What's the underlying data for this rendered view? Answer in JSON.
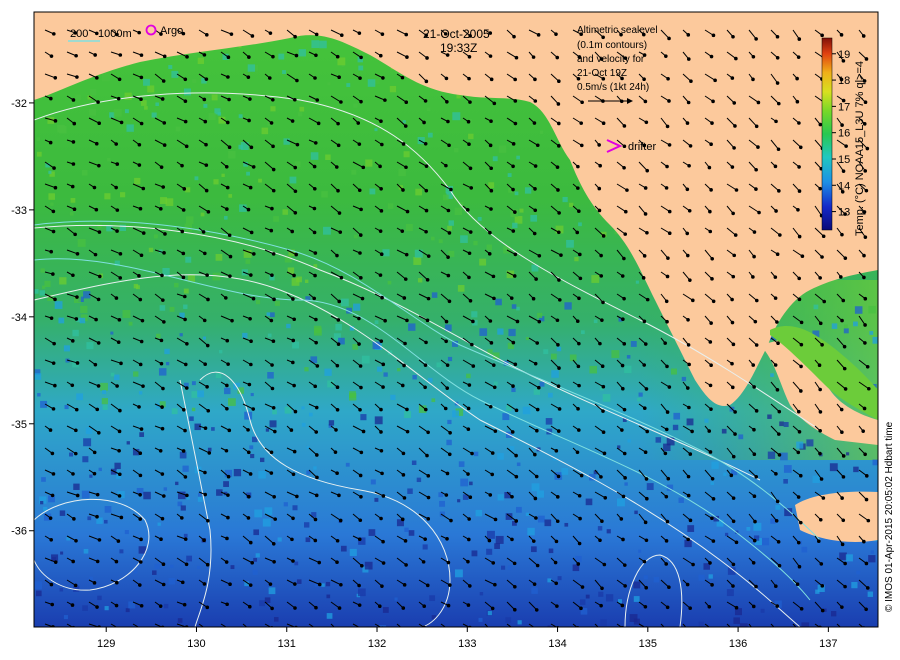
{
  "title": {
    "date": "21-Oct-2005",
    "time": "19:33Z"
  },
  "legend": {
    "depth_label_a": "200",
    "depth_label_b": "1000m",
    "argo_label": "Argo",
    "drifter_label": "drifter",
    "argo_color": "#e000e0",
    "drifter_color": "#e000e0",
    "isobath_color": "#80e0e0"
  },
  "altimetry_note": {
    "line1": "Altimetric sealevel",
    "line2": "(0.1m contours)",
    "line3": "and velocity for",
    "line4": "21-Oct 19Z",
    "line5": "0.5m/s (1kt 24h)"
  },
  "colorbar": {
    "label": "Temp. (°C) NOAA15_L3U 7% ql>=4",
    "ticks": [
      "13",
      "14",
      "15",
      "16",
      "17",
      "18",
      "19"
    ],
    "range": [
      12.3,
      19.6
    ]
  },
  "credit": "© IMOS 01-Apr-2015 20:05:02 Hdbart time",
  "axes": {
    "lon_ticks": [
      "129",
      "130",
      "131",
      "132",
      "133",
      "134",
      "135",
      "136",
      "137"
    ],
    "lon_values": [
      129,
      130,
      131,
      132,
      133,
      134,
      135,
      136,
      137
    ],
    "lat_ticks": [
      "-32",
      "-33",
      "-34",
      "-35",
      "-36"
    ],
    "lat_values": [
      -32,
      -33,
      -34,
      -35,
      -36
    ],
    "lon_range": [
      128.2,
      137.55
    ],
    "lat_range": [
      -36.9,
      -31.15
    ]
  },
  "colors": {
    "land": "#fcc99c",
    "sst_cold": "#0a1e8c",
    "sst_mid": "#2ab04a",
    "sst_warm": "#c8d020"
  }
}
